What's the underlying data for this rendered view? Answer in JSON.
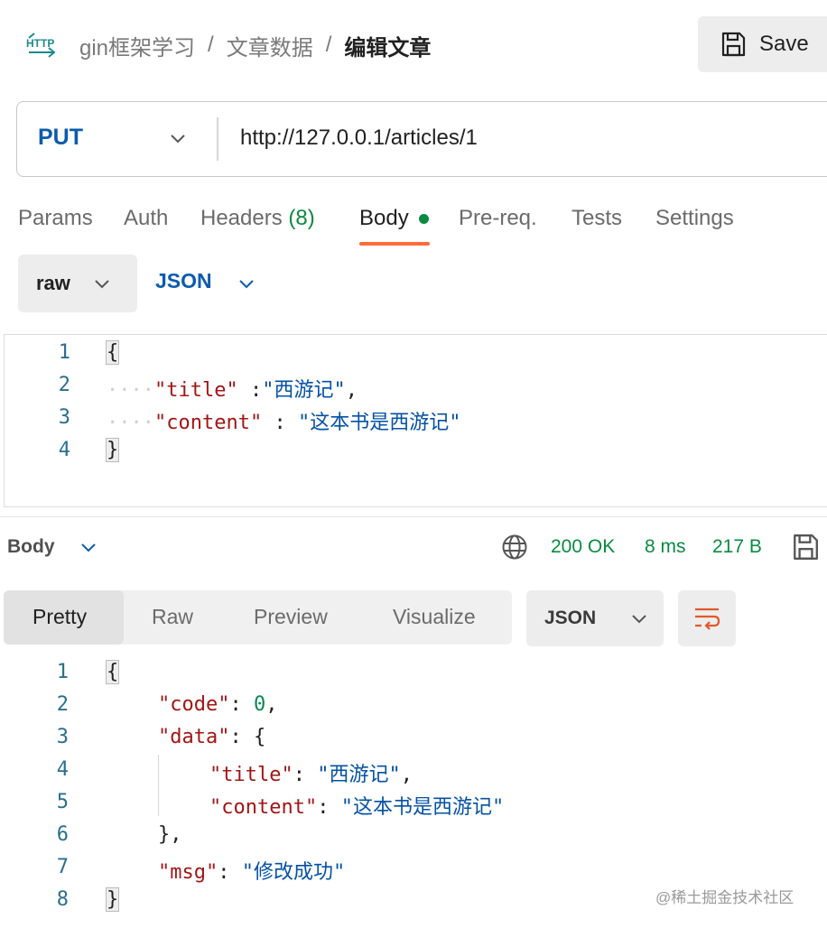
{
  "header": {
    "breadcrumb": [
      "gin框架学习",
      "文章数据"
    ],
    "current": "编辑文章",
    "save_label": "Save",
    "icon": "http-icon"
  },
  "request": {
    "method": "PUT",
    "url": "http://127.0.0.1/articles/1",
    "tabs": {
      "params": "Params",
      "auth": "Auth",
      "headers": "Headers",
      "headers_count": "(8)",
      "body": "Body",
      "prereq": "Pre-req.",
      "tests": "Tests",
      "settings": "Settings"
    },
    "body_mode": "raw",
    "body_format": "JSON",
    "body_lines": [
      {
        "n": "1",
        "text": "{"
      },
      {
        "n": "2",
        "key": "\"title\"",
        "sep": " :",
        "val": "\"西游记\"",
        "end": ","
      },
      {
        "n": "3",
        "key": "\"content\"",
        "sep": " : ",
        "val": "\"这本书是西游记\"",
        "end": ""
      },
      {
        "n": "4",
        "text": "}"
      }
    ]
  },
  "response": {
    "label": "Body",
    "status": "200 OK",
    "time": "8 ms",
    "size": "217 B",
    "tabs": {
      "pretty": "Pretty",
      "raw": "Raw",
      "preview": "Preview",
      "visualize": "Visualize"
    },
    "format": "JSON",
    "lines": [
      {
        "n": "1",
        "text": "{"
      },
      {
        "n": "2",
        "key": "\"code\"",
        "sep": ": ",
        "val": "0",
        "end": ","
      },
      {
        "n": "3",
        "key": "\"data\"",
        "sep": ": ",
        "val": "{",
        "end": ""
      },
      {
        "n": "4",
        "key": "\"title\"",
        "sep": ": ",
        "val": "\"西游记\"",
        "end": ","
      },
      {
        "n": "5",
        "key": "\"content\"",
        "sep": ": ",
        "val": "\"这本书是西游记\"",
        "end": ""
      },
      {
        "n": "6",
        "text": "},"
      },
      {
        "n": "7",
        "key": "\"msg\"",
        "sep": ": ",
        "val": "\"修改成功\"",
        "end": ""
      },
      {
        "n": "8",
        "text": "}"
      }
    ]
  },
  "watermark": "@稀土掘金技术社区",
  "colors": {
    "accent": "#ff6c37",
    "success": "#0a8a42",
    "method": "#0b5cad"
  }
}
